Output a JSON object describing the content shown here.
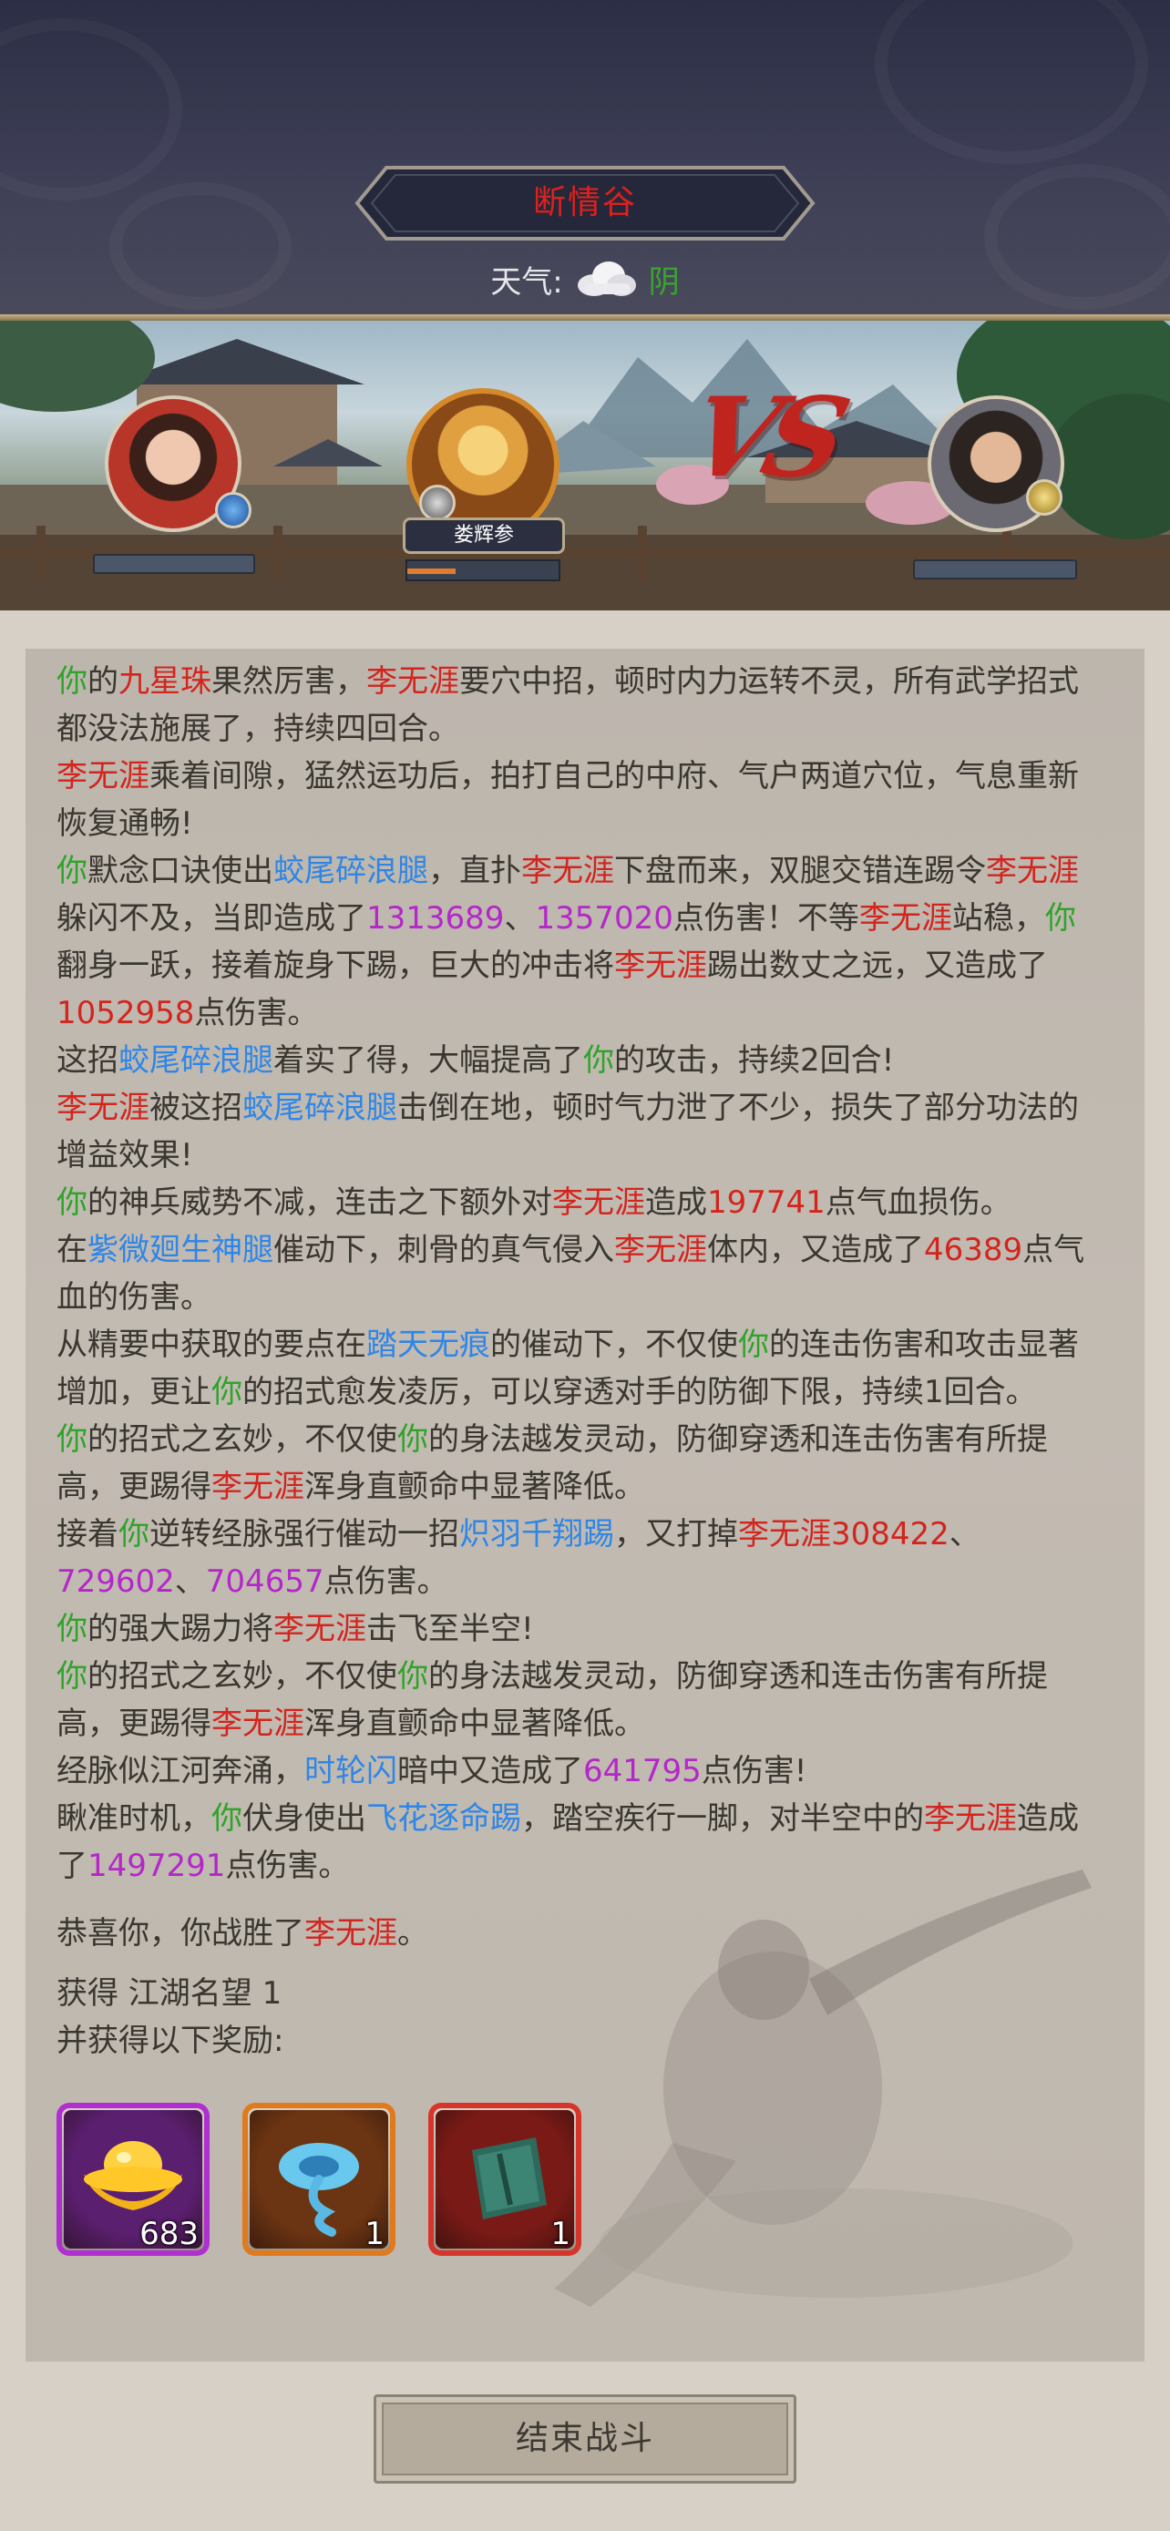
{
  "header": {
    "location_name": "断情谷",
    "weather_label": "天气:",
    "weather_value": "阴",
    "weather_icon": "cloud-icon"
  },
  "battle": {
    "center_fighter_name": "娄辉参",
    "center_energy_fraction": 0.32,
    "vs_label": "VS",
    "left_badge_icon": "water-element-icon",
    "right_badge_icon": "gold-element-icon",
    "center_badge_icon": "yin-yang-icon"
  },
  "log": [
    [
      [
        "g",
        "你"
      ],
      [
        "n",
        "的"
      ],
      [
        "r",
        "九星珠"
      ],
      [
        "n",
        "果然厉害，"
      ],
      [
        "r",
        "李无涯"
      ],
      [
        "n",
        "要穴中招，顿时内力运转不灵，所有武学招式都没法施展了，持续四回合。"
      ]
    ],
    [
      [
        "r",
        "李无涯"
      ],
      [
        "n",
        "乘着间隙，猛然运功后，拍打自己的中府、气户两道穴位，气息重新恢复通畅!"
      ]
    ],
    [
      [
        "g",
        "你"
      ],
      [
        "n",
        "默念口诀使出"
      ],
      [
        "b",
        "蛟尾碎浪腿"
      ],
      [
        "n",
        "，直扑"
      ],
      [
        "r",
        "李无涯"
      ],
      [
        "n",
        "下盘而来，双腿交错连踢令"
      ],
      [
        "r",
        "李无涯"
      ],
      [
        "n",
        "躲闪不及，当即造成了"
      ],
      [
        "p",
        "1313689"
      ],
      [
        "n",
        "、"
      ],
      [
        "p",
        "1357020"
      ],
      [
        "n",
        "点伤害！不等"
      ],
      [
        "r",
        "李无涯"
      ],
      [
        "n",
        "站稳，"
      ],
      [
        "g",
        "你"
      ],
      [
        "n",
        "翻身一跃，接着旋身下踢，巨大的冲击将"
      ],
      [
        "r",
        "李无涯"
      ],
      [
        "n",
        "踢出数丈之远，又造成了"
      ],
      [
        "r",
        "1052958"
      ],
      [
        "n",
        "点伤害。"
      ]
    ],
    [
      [
        "n",
        "这招"
      ],
      [
        "b",
        "蛟尾碎浪腿"
      ],
      [
        "n",
        "着实了得，大幅提高了"
      ],
      [
        "g",
        "你"
      ],
      [
        "n",
        "的攻击，持续2回合!"
      ]
    ],
    [
      [
        "r",
        "李无涯"
      ],
      [
        "n",
        "被这招"
      ],
      [
        "b",
        "蛟尾碎浪腿"
      ],
      [
        "n",
        "击倒在地，顿时气力泄了不少，损失了部分功法的增益效果!"
      ]
    ],
    [
      [
        "g",
        "你"
      ],
      [
        "n",
        "的神兵威势不减，连击之下额外对"
      ],
      [
        "r",
        "李无涯"
      ],
      [
        "n",
        "造成"
      ],
      [
        "r",
        "197741"
      ],
      [
        "n",
        "点气血损伤。"
      ]
    ],
    [
      [
        "n",
        "在"
      ],
      [
        "b",
        "紫微廻生神腿"
      ],
      [
        "n",
        "催动下，刺骨的真气侵入"
      ],
      [
        "r",
        "李无涯"
      ],
      [
        "n",
        "体内，又造成了"
      ],
      [
        "r",
        "46389"
      ],
      [
        "n",
        "点气血的伤害。"
      ]
    ],
    [
      [
        "n",
        "从精要中获取的要点在"
      ],
      [
        "b",
        "踏天无痕"
      ],
      [
        "n",
        "的催动下，不仅使"
      ],
      [
        "g",
        "你"
      ],
      [
        "n",
        "的连击伤害和攻击显著增加，更让"
      ],
      [
        "g",
        "你"
      ],
      [
        "n",
        "的招式愈发凌厉，可以穿透对手的防御下限，持续1回合。"
      ]
    ],
    [
      [
        "g",
        "你"
      ],
      [
        "n",
        "的招式之玄妙，不仅使"
      ],
      [
        "g",
        "你"
      ],
      [
        "n",
        "的身法越发灵动，防御穿透和连击伤害有所提高，更踢得"
      ],
      [
        "r",
        "李无涯"
      ],
      [
        "n",
        "浑身直颤命中显著降低。"
      ]
    ],
    [
      [
        "n",
        "接着"
      ],
      [
        "g",
        "你"
      ],
      [
        "n",
        "逆转经脉强行催动一招"
      ],
      [
        "b",
        "炽羽千翔踢"
      ],
      [
        "n",
        "，又打掉"
      ],
      [
        "r",
        "李无涯"
      ],
      [
        "r",
        "308422"
      ],
      [
        "n",
        "、"
      ],
      [
        "p",
        "729602"
      ],
      [
        "n",
        "、"
      ],
      [
        "p",
        "704657"
      ],
      [
        "n",
        "点伤害。"
      ]
    ],
    [
      [
        "g",
        "你"
      ],
      [
        "n",
        "的强大踢力将"
      ],
      [
        "r",
        "李无涯"
      ],
      [
        "n",
        "击飞至半空!"
      ]
    ],
    [
      [
        "g",
        "你"
      ],
      [
        "n",
        "的招式之玄妙，不仅使"
      ],
      [
        "g",
        "你"
      ],
      [
        "n",
        "的身法越发灵动，防御穿透和连击伤害有所提高，更踢得"
      ],
      [
        "r",
        "李无涯"
      ],
      [
        "n",
        "浑身直颤命中显著降低。"
      ]
    ],
    [
      [
        "n",
        "经脉似江河奔涌，"
      ],
      [
        "b",
        "时轮闪"
      ],
      [
        "n",
        "暗中又造成了"
      ],
      [
        "p",
        "641795"
      ],
      [
        "n",
        "点伤害!"
      ]
    ],
    [
      [
        "n",
        "瞅准时机，"
      ],
      [
        "g",
        "你"
      ],
      [
        "n",
        "伏身使出"
      ],
      [
        "b",
        "飞花逐命踢"
      ],
      [
        "n",
        "，踏空疾行一脚，对半空中的"
      ],
      [
        "r",
        "李无涯"
      ],
      [
        "n",
        "造成了"
      ],
      [
        "p",
        "1497291"
      ],
      [
        "n",
        "点伤害。"
      ]
    ]
  ],
  "result": {
    "victory": [
      [
        "n",
        "恭喜你，你战胜了"
      ],
      [
        "r",
        "李无涯"
      ],
      [
        "n",
        "。"
      ]
    ],
    "gain_line": "获得 江湖名望 1",
    "rewards_intro": "并获得以下奖励:"
  },
  "rewards": [
    {
      "icon": "gold-ingot-icon",
      "count": "683",
      "frame_color": "#b02fd0",
      "bg_color": "#5a1f6e"
    },
    {
      "icon": "blue-swirl-orb-icon",
      "count": "1",
      "frame_color": "#e07a1c",
      "bg_color": "#6b3412"
    },
    {
      "icon": "manual-book-icon",
      "count": "1",
      "frame_color": "#d8352a",
      "bg_color": "#7a1a16"
    }
  ],
  "colors": {
    "you": "#2fa32a",
    "enemy": "#d2251e",
    "skill": "#2f86e6",
    "damage": "#b427c8"
  },
  "footer": {
    "end_battle_label": "结束战斗"
  }
}
